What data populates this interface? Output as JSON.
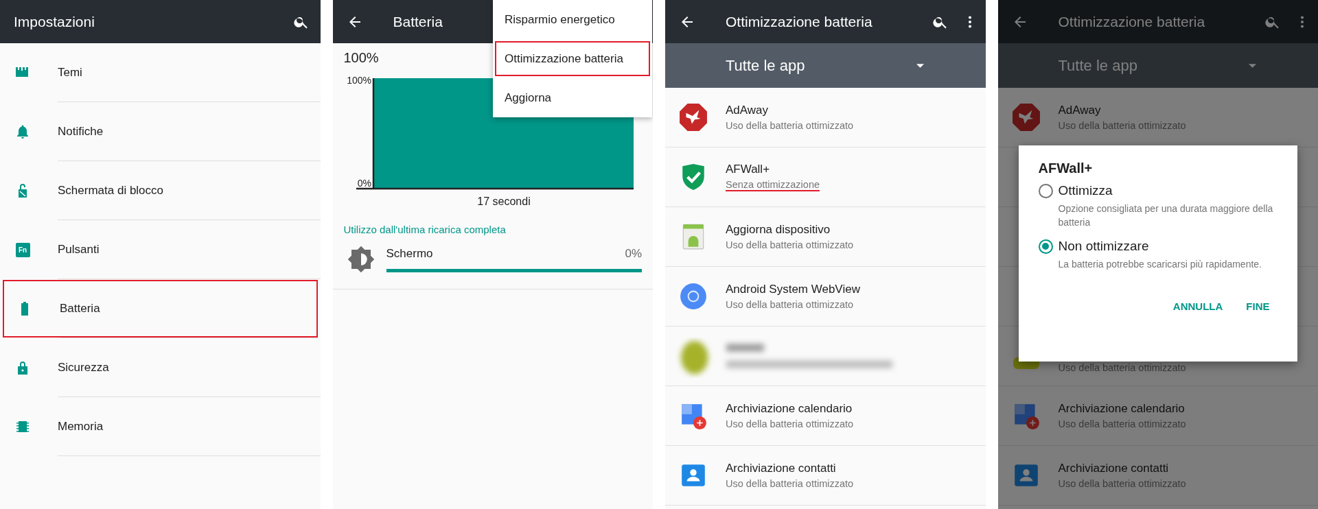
{
  "settings": {
    "title": "Impostazioni",
    "items": [
      {
        "label": "Temi",
        "highlighted": false
      },
      {
        "label": "Notifiche",
        "highlighted": false
      },
      {
        "label": "Schermata di blocco",
        "highlighted": false
      },
      {
        "label": "Pulsanti",
        "highlighted": false,
        "icon_text": "Fn"
      },
      {
        "label": "Batteria",
        "highlighted": true
      },
      {
        "label": "Sicurezza",
        "highlighted": false
      },
      {
        "label": "Memoria",
        "highlighted": false
      }
    ]
  },
  "battery": {
    "title": "Batteria",
    "charge": "100%",
    "graph": {
      "top_label": "100%",
      "bottom_label": "0%",
      "time_label": "17 secondi"
    },
    "section_title": "Utilizzo dall'ultima ricarica completa",
    "usage": [
      {
        "name": "Schermo",
        "reading": "0%",
        "level": 1
      }
    ],
    "menu": [
      {
        "label": "Risparmio energetico",
        "highlighted": false
      },
      {
        "label": "Ottimizzazione batteria",
        "highlighted": true
      },
      {
        "label": "Aggiorna",
        "highlighted": false
      }
    ]
  },
  "optimization": {
    "title": "Ottimizzazione batteria",
    "filter": "Tutte le app",
    "apps": [
      {
        "kind": "app",
        "name": "AdAway",
        "status": "Uso della batteria ottimizzato",
        "underlined": false
      },
      {
        "kind": "app",
        "name": "AFWall+",
        "status": "Senza ottimizzazione",
        "underlined": true
      },
      {
        "kind": "app",
        "name": "Aggiorna dispositivo",
        "status": "Uso della batteria ottimizzato",
        "underlined": false
      },
      {
        "kind": "app",
        "name": "Android System WebView",
        "status": "Uso della batteria ottimizzato",
        "underlined": false
      },
      {
        "kind": "blurred"
      },
      {
        "kind": "app",
        "name": "Archiviazione calendario",
        "status": "Uso della batteria ottimizzato",
        "underlined": false
      },
      {
        "kind": "app",
        "name": "Archiviazione contatti",
        "status": "Uso della batteria ottimizzato",
        "underlined": false
      }
    ]
  },
  "dialog_screen": {
    "title": "Ottimizzazione batteria",
    "filter": "Tutte le app",
    "rows": [
      {
        "kind": "app",
        "name": "AdAway",
        "status": "Uso della batteria ottimizzato"
      },
      {
        "kind": "covered"
      },
      {
        "kind": "covered"
      },
      {
        "kind": "covered"
      },
      {
        "kind": "status_only",
        "status": "Uso della batteria ottimizzato"
      },
      {
        "kind": "app",
        "name": "Archiviazione calendario",
        "status": "Uso della batteria ottimizzato"
      },
      {
        "kind": "app",
        "name": "Archiviazione contatti",
        "status": "Uso della batteria ottimizzato"
      }
    ],
    "dialog": {
      "title": "AFWall+",
      "options": [
        {
          "label": "Ottimizza",
          "description": "Opzione consigliata per una durata maggiore della batteria",
          "selected": false
        },
        {
          "label": "Non ottimizzare",
          "description": "La batteria potrebbe scaricarsi più rapidamente.",
          "selected": true
        }
      ],
      "buttons": [
        "ANNULLA",
        "FINE"
      ]
    }
  }
}
